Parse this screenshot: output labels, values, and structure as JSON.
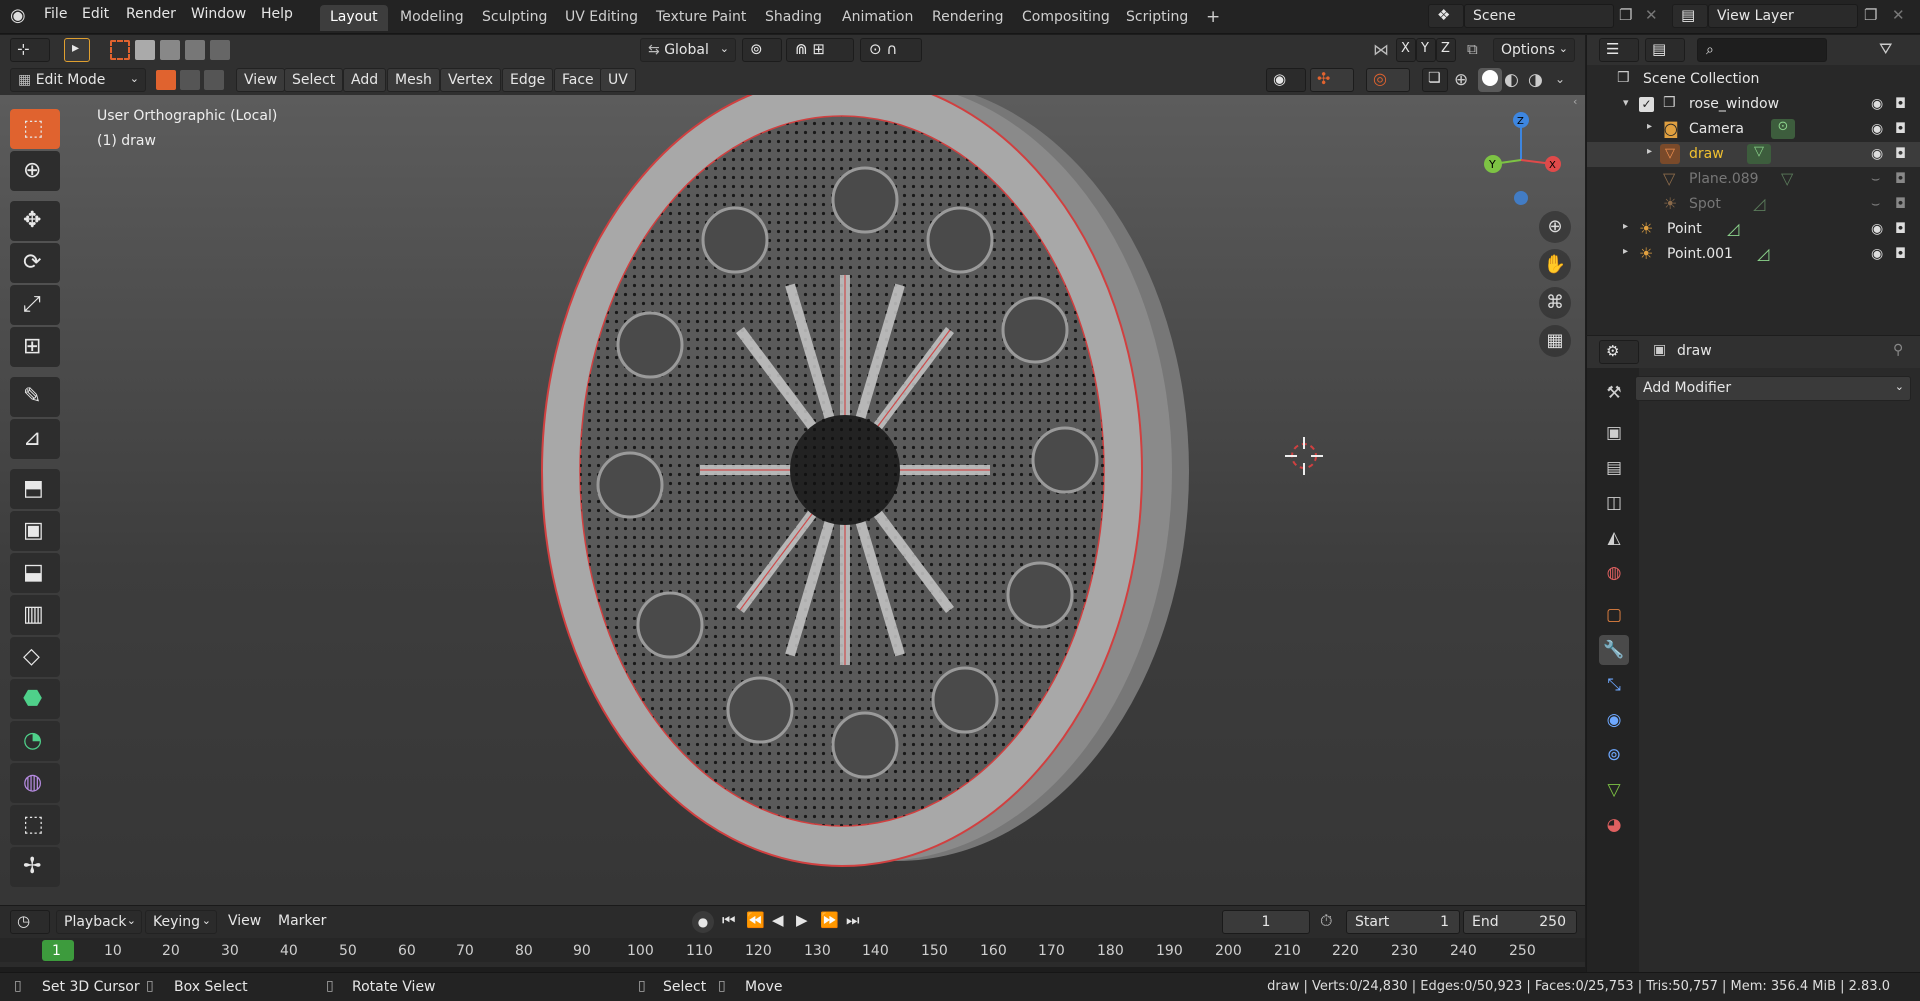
{
  "menubar": {
    "logo_icon": "blender-logo-icon",
    "items": [
      "File",
      "Edit",
      "Render",
      "Window",
      "Help"
    ]
  },
  "workspaces": {
    "tabs": [
      "Layout",
      "Modeling",
      "Sculpting",
      "UV Editing",
      "Texture Paint",
      "Shading",
      "Animation",
      "Rendering",
      "Compositing",
      "Scripting"
    ],
    "active": "Layout",
    "add_label": "+"
  },
  "scene": {
    "label": "Scene",
    "view_layer": "View Layer"
  },
  "toolheader": {
    "transform_orientation": "Global",
    "axes": [
      "X",
      "Y",
      "Z"
    ],
    "options_label": "Options"
  },
  "viewport_header": {
    "mode": "Edit Mode",
    "menus": [
      "View",
      "Select",
      "Add",
      "Mesh",
      "Vertex",
      "Edge",
      "Face",
      "UV"
    ]
  },
  "viewport": {
    "view_label": "User Orthographic (Local)",
    "object_label": "(1) draw",
    "gizmo_axes": {
      "z": "Z",
      "y": "Y",
      "x": "X"
    }
  },
  "tools": [
    "select-box-icon",
    "cursor-icon",
    "move-icon",
    "rotate-icon",
    "scale-icon",
    "transform-icon",
    "annotate-icon",
    "measure-icon",
    "extrude-icon",
    "inset-icon",
    "bevel-icon",
    "loop-cut-icon",
    "knife-icon",
    "poly-build-icon",
    "spin-icon",
    "smooth-icon",
    "shrink-icon",
    "shear-icon"
  ],
  "outliner": {
    "root": "Scene Collection",
    "rows": [
      {
        "name": "rose_window",
        "type": "collection",
        "dim": false
      },
      {
        "name": "Camera",
        "type": "camera",
        "dim": false
      },
      {
        "name": "draw",
        "type": "mesh",
        "dim": false,
        "selected": true
      },
      {
        "name": "Plane.089",
        "type": "mesh",
        "dim": true
      },
      {
        "name": "Spot",
        "type": "light",
        "dim": true
      },
      {
        "name": "Point",
        "type": "light",
        "dim": false
      },
      {
        "name": "Point.001",
        "type": "light",
        "dim": false
      }
    ]
  },
  "properties": {
    "object_name": "draw",
    "add_modifier_label": "Add Modifier"
  },
  "timeline": {
    "menus": [
      "Playback",
      "Keying",
      "View",
      "Marker"
    ],
    "current_frame": "1",
    "start_label": "Start",
    "start": "1",
    "end_label": "End",
    "end": "250",
    "ticks": [
      "1",
      "10",
      "20",
      "30",
      "40",
      "50",
      "60",
      "70",
      "80",
      "90",
      "100",
      "110",
      "120",
      "130",
      "140",
      "150",
      "160",
      "170",
      "180",
      "190",
      "200",
      "210",
      "220",
      "230",
      "240",
      "250"
    ]
  },
  "statusbar": {
    "hints": [
      "Set 3D Cursor",
      "Box Select",
      "Rotate View",
      "Select",
      "Move"
    ],
    "stats": "draw | Verts:0/24,830 | Edges:0/50,923 | Faces:0/25,753 | Tris:50,757 | Mem: 356.4 MiB | 2.83.0"
  },
  "colors": {
    "accent": "#e0632f",
    "selected_text": "#f0c030",
    "x_axis": "#e04a4a",
    "y_axis": "#7dc344",
    "z_axis": "#3d86e0",
    "edge_highlight": "#e03030"
  }
}
